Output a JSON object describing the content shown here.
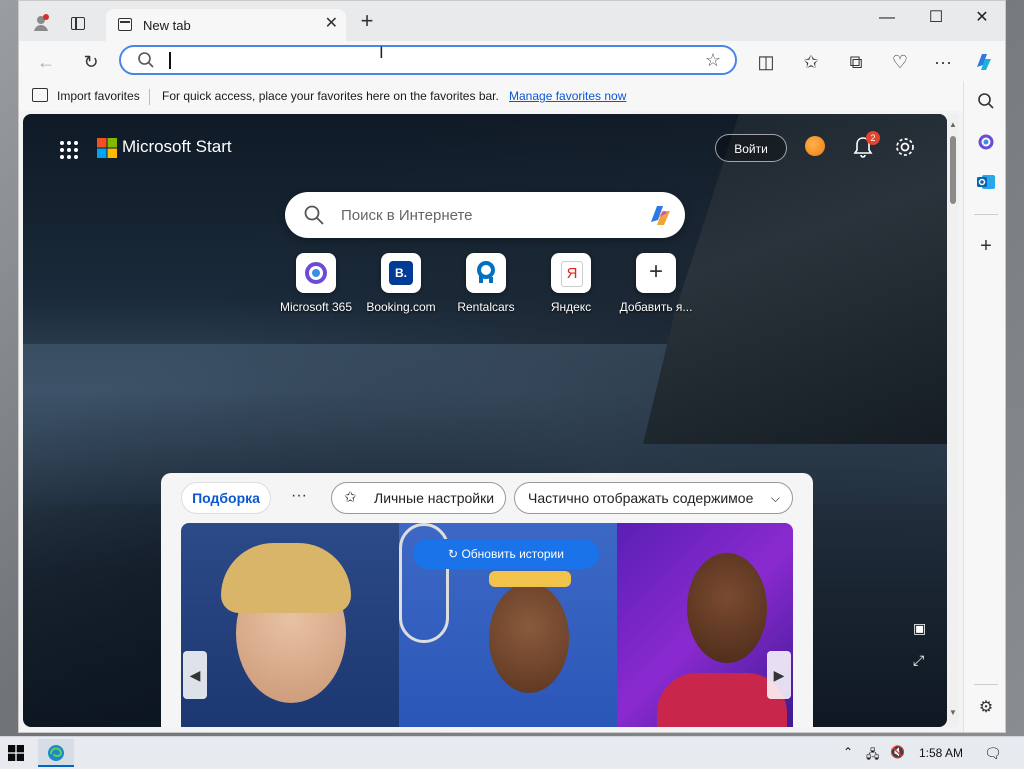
{
  "browser": {
    "tab": {
      "title": "New tab",
      "close": "✕"
    },
    "new_tab": "+",
    "window_controls": {
      "minimize": "—",
      "maximize": "☐",
      "close": "✕"
    },
    "address": {
      "value": "",
      "placeholder": ""
    },
    "favorites_bar": {
      "import": "Import favorites",
      "message": "For quick access, place your favorites here on the favorites bar.",
      "manage_link": "Manage favorites now"
    }
  },
  "newtab": {
    "brand": "Microsoft Start",
    "sign_in": "Войти",
    "notification_count": "2",
    "search_placeholder": "Поиск в Интернете",
    "quick_links": [
      {
        "label": "Microsoft 365",
        "icon": "m365-icon"
      },
      {
        "label": "Booking.com",
        "icon": "booking-icon",
        "glyph": "B."
      },
      {
        "label": "Rentalcars",
        "icon": "rentalcars-icon"
      },
      {
        "label": "Яндекс",
        "icon": "yandex-icon",
        "glyph": "Я"
      },
      {
        "label": "Добавить я...",
        "icon": "plus-icon",
        "glyph": "+"
      }
    ],
    "feed": {
      "tabs": [
        "Подборка"
      ],
      "more": "···",
      "personalize": "Личные настройки",
      "content_mode": "Частично отображать содержимое",
      "refresh": "Обновить истории"
    }
  },
  "taskbar": {
    "time": "1:58 AM"
  },
  "colors": {
    "accent": "#0b57d0",
    "refresh_button": "#1a73e8",
    "badge": "#e0452e"
  }
}
